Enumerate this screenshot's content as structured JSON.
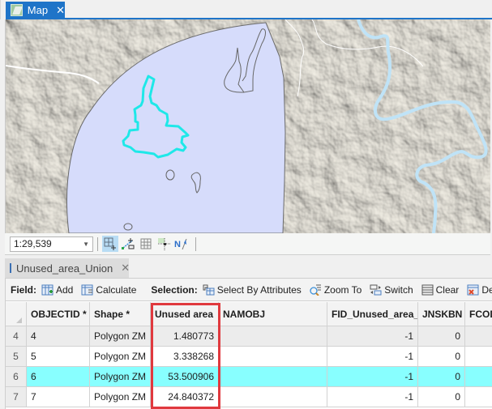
{
  "map_tab": {
    "title": "Map",
    "close_glyph": "✕",
    "icon": "map-icon"
  },
  "map": {
    "basemap": "hillshade terrain",
    "colors": {
      "buffer_fill": "#d6dcfb",
      "buffer_outline": "#6b6b6b",
      "selected_outline": "#1ee8e8",
      "river": "#bfe3f7",
      "road": "#ffffff"
    }
  },
  "map_toolbar": {
    "scale": "1:29,539",
    "tools": [
      {
        "name": "snapping-icon",
        "active": true
      },
      {
        "name": "edit-vertices-icon",
        "active": false
      },
      {
        "name": "grid-icon",
        "active": false
      },
      {
        "name": "constraint-icon",
        "active": false
      },
      {
        "name": "north-arrow-correction-icon",
        "active": false
      }
    ]
  },
  "table_tab": {
    "title": "Unused_area_Union",
    "close_glyph": "✕",
    "icon": "table-icon"
  },
  "table_toolbar": {
    "field_label": "Field:",
    "add": "Add",
    "calculate": "Calculate",
    "selection_label": "Selection:",
    "select_by_attributes": "Select By Attributes",
    "zoom_to": "Zoom To",
    "switch": "Switch",
    "clear": "Clear",
    "delete": "De"
  },
  "table": {
    "columns": [
      "OBJECTID *",
      "Shape *",
      "Unused area",
      "NAMOBJ",
      "FID_Unused_area_",
      "JNSKBN",
      "FCOD"
    ],
    "highlighted_column": "Unused area",
    "rows": [
      {
        "row_num": "4",
        "objectid": "4",
        "shape": "Polygon ZM",
        "unused_area": "1.480773",
        "namobj": "",
        "fid": "-1",
        "jnskbn": "0",
        "fcod": "",
        "state": "alt"
      },
      {
        "row_num": "5",
        "objectid": "5",
        "shape": "Polygon ZM",
        "unused_area": "3.338268",
        "namobj": "",
        "fid": "-1",
        "jnskbn": "0",
        "fcod": "",
        "state": "normal"
      },
      {
        "row_num": "6",
        "objectid": "6",
        "shape": "Polygon ZM",
        "unused_area": "53.500906",
        "namobj": "",
        "fid": "-1",
        "jnskbn": "0",
        "fcod": "",
        "state": "selected"
      },
      {
        "row_num": "7",
        "objectid": "7",
        "shape": "Polygon ZM",
        "unused_area": "24.840372",
        "namobj": "",
        "fid": "-1",
        "jnskbn": "0",
        "fcod": "",
        "state": "normal"
      }
    ]
  }
}
